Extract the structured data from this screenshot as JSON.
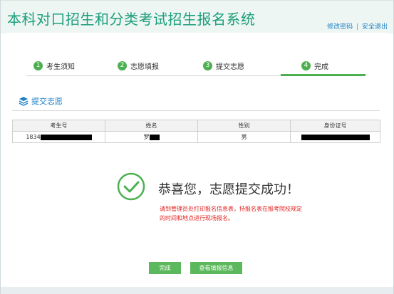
{
  "header": {
    "title": "本科对口招生和分类考试招生报名系统",
    "links": [
      "修改密码",
      "安全退出"
    ],
    "separator": "|"
  },
  "steps": [
    {
      "num": "1",
      "label": "考生须知"
    },
    {
      "num": "2",
      "label": "志愿填报"
    },
    {
      "num": "3",
      "label": "提交志愿"
    },
    {
      "num": "4",
      "label": "完成"
    }
  ],
  "section": {
    "title": "提交志愿",
    "icon": "layers-icon"
  },
  "table": {
    "headers": [
      "考生号",
      "姓名",
      "性别",
      "身份证号"
    ],
    "row": {
      "exam_no": "1834",
      "name": "罗",
      "gender": "男",
      "id_no": ""
    }
  },
  "result": {
    "message": "恭喜您，志愿提交成功！",
    "note": "请到管理员处打印报名信息表，持报名表在报考院校规定的时间和地点进行现场报名。",
    "icon": "check-circle-icon"
  },
  "buttons": {
    "finish": "完成",
    "view_info": "查看填报信息"
  },
  "colors": {
    "brand": "#1b9e7a",
    "step_green": "#4cb050",
    "link_blue": "#1c7fc4",
    "note_red": "#e02020",
    "button_green": "#5cb85c"
  }
}
